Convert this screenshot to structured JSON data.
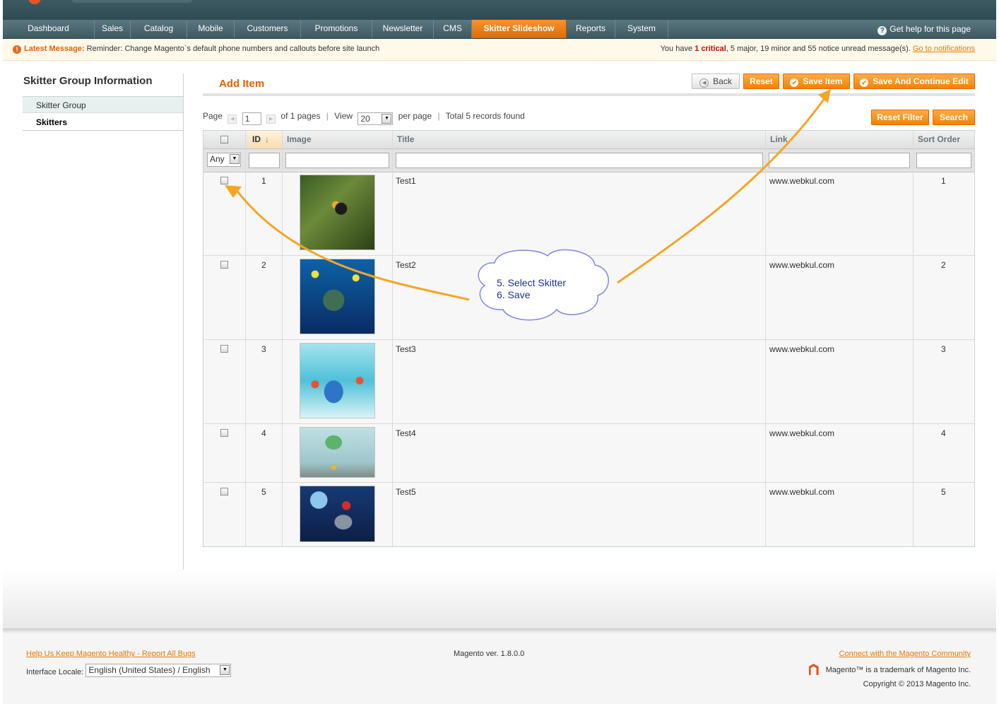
{
  "nav": {
    "items": [
      "Dashboard",
      "Sales",
      "Catalog",
      "Mobile",
      "Customers",
      "Promotions",
      "Newsletter",
      "CMS",
      "Skitter Slideshow",
      "Reports",
      "System"
    ],
    "active_index": 8,
    "help": "Get help for this page"
  },
  "message": {
    "label": "Latest Message:",
    "text": "Reminder: Change Magento`s default phone numbers and callouts before site launch",
    "summary_prefix": "You have",
    "critical": "1 critical",
    "summary_rest": ", 5 major, 19 minor and 55 notice unread message(s).",
    "link": "Go to notifications"
  },
  "sidebar": {
    "title": "Skitter Group Information",
    "tabs": [
      "Skitter Group",
      "Skitters"
    ],
    "active_tab": 1
  },
  "content": {
    "title": "Add Item",
    "buttons": {
      "back": "Back",
      "reset": "Reset",
      "save": "Save Item",
      "save_continue": "Save And Continue Edit"
    }
  },
  "pager": {
    "page_label": "Page",
    "page_value": "1",
    "of_pages": "of 1 pages",
    "view_label": "View",
    "view_value": "20",
    "per_page": "per page",
    "total": "Total 5 records found",
    "reset_filter": "Reset Filter",
    "search": "Search"
  },
  "grid": {
    "columns": [
      "ID",
      "Image",
      "Title",
      "Link",
      "Sort Order"
    ],
    "filter_any": "Any",
    "rows": [
      {
        "id": "1",
        "title": "Test1",
        "link": "www.webkul.com",
        "sort": "1"
      },
      {
        "id": "2",
        "title": "Test2",
        "link": "www.webkul.com",
        "sort": "2"
      },
      {
        "id": "3",
        "title": "Test3",
        "link": "www.webkul.com",
        "sort": "3"
      },
      {
        "id": "4",
        "title": "Test4",
        "link": "www.webkul.com",
        "sort": "4"
      },
      {
        "id": "5",
        "title": "Test5",
        "link": "www.webkul.com",
        "sort": "5"
      }
    ]
  },
  "annotation": {
    "line1": "5. Select Skitter",
    "line2": "6. Save",
    "arrow_color": "#f5a623"
  },
  "footer": {
    "report": "Help Us Keep Magento Healthy - Report All Bugs",
    "locale_label": "Interface Locale:",
    "locale_value": "English (United States) / English",
    "version": "Magento ver. 1.8.0.0",
    "community": "Connect with the Magento Community",
    "trademark": "Magento™ is a trademark of Magento Inc.",
    "copyright": "Copyright © 2013 Magento Inc."
  },
  "colors": {
    "accent": "#eb5e00",
    "nav": "#4a666f",
    "button": "#f18200"
  }
}
